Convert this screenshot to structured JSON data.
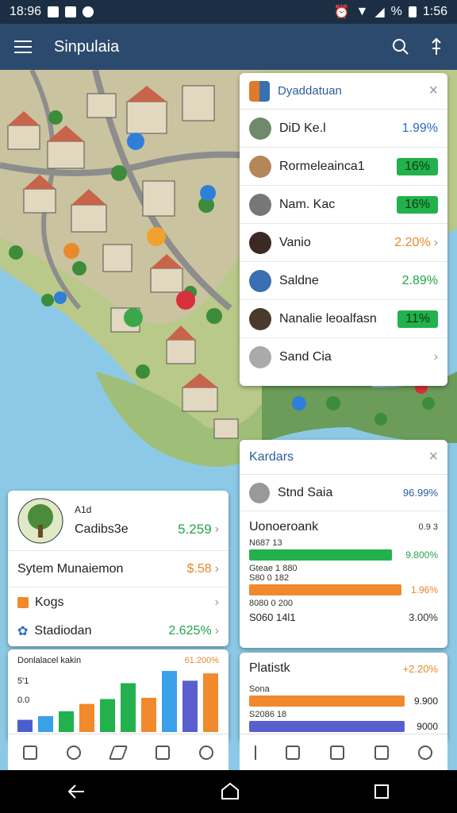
{
  "status": {
    "time_left": "18:96",
    "time_right": "1:56",
    "battery_label": "%"
  },
  "app": {
    "title": "Sinpulaia"
  },
  "list_panel": {
    "title": "Dyaddatuan",
    "items": [
      {
        "name": "DiD Ke.l",
        "value": "1.99%",
        "color": "#2b6cc4"
      },
      {
        "name": "Rormeleainca1",
        "value": "16%",
        "pill": true
      },
      {
        "name": "Nam. Kac",
        "value": "16%",
        "pill": true
      },
      {
        "name": "Vanio",
        "value": "2.20%",
        "color": "#e8872a"
      },
      {
        "name": "Saldne",
        "value": "2.89%",
        "color": "#22a44a"
      },
      {
        "name": "Nanalie leoalfasn",
        "value": "11%",
        "pill": true
      },
      {
        "name": "Sand Cia",
        "value": ""
      }
    ]
  },
  "stats_panel": {
    "title": "Kardars",
    "top_row": {
      "name": "Stnd Saia",
      "value": "96.99%"
    },
    "header": "Uonoeroank",
    "header_value": "0.9 3",
    "rows": [
      {
        "label": "N687 13",
        "value": "9.800%",
        "color": "#22b14c",
        "fraction": 0.9
      },
      {
        "label": "S80 0 182",
        "value": "1.96%",
        "color": "#f08a2c",
        "fraction": 0.78
      },
      {
        "label": "8080 0 200",
        "value": "",
        "color": "#f08a2c",
        "fraction": 0
      },
      {
        "label": "S060 14l1",
        "value": "3.00%",
        "color": "#f08a2c",
        "fraction": 0
      }
    ],
    "sub_labels": [
      "Gteae 1 880",
      "8080 0 280"
    ]
  },
  "plat_panel": {
    "title": "Platistk",
    "value": "+2.20%",
    "rows": [
      {
        "label": "Sona",
        "value": "9.900",
        "color": "#f08a2c",
        "fraction": 0.82
      },
      {
        "label": "S2086 18",
        "value": "9000",
        "color": "#5a5fcf",
        "fraction": 0.82
      }
    ]
  },
  "left_panel": {
    "avatar_label": "A1d",
    "top_name": "Cadibs3e",
    "top_value": "5.259",
    "rows": [
      {
        "name": "Sytem Munaiemon",
        "value": "$.58",
        "color": "#e8872a"
      },
      {
        "name": "Kogs",
        "value": "",
        "color": "#333"
      },
      {
        "name": "Stadiodan",
        "value": "2.625%",
        "color": "#22a44a"
      }
    ]
  },
  "chart_panel": {
    "title": "Donlalacel kakin",
    "value_label": "61.200%",
    "y_labels": [
      "5'1",
      "0.0"
    ]
  },
  "chart_data": {
    "type": "bar",
    "categories": [
      "",
      "",
      "",
      "",
      "",
      "",
      "",
      "",
      "",
      ""
    ],
    "values": [
      1,
      1.3,
      1.7,
      2.3,
      2.7,
      4,
      2.8,
      5,
      4.2,
      4.8
    ],
    "colors": [
      "#4a5fcf",
      "#3aa0e8",
      "#22b14c",
      "#f08a2c",
      "#22b14c",
      "#22b14c",
      "#f08a2c",
      "#3aa0e8",
      "#5a5fcf",
      "#f08a2c"
    ],
    "ylim": [
      0,
      5.2
    ]
  },
  "icons": {
    "menu": "menu-icon",
    "search": "search-icon",
    "share": "share-icon",
    "close": "close-icon",
    "chevron": "chevron-right-icon",
    "back": "back-icon",
    "home": "home-icon",
    "recents": "recents-icon"
  }
}
